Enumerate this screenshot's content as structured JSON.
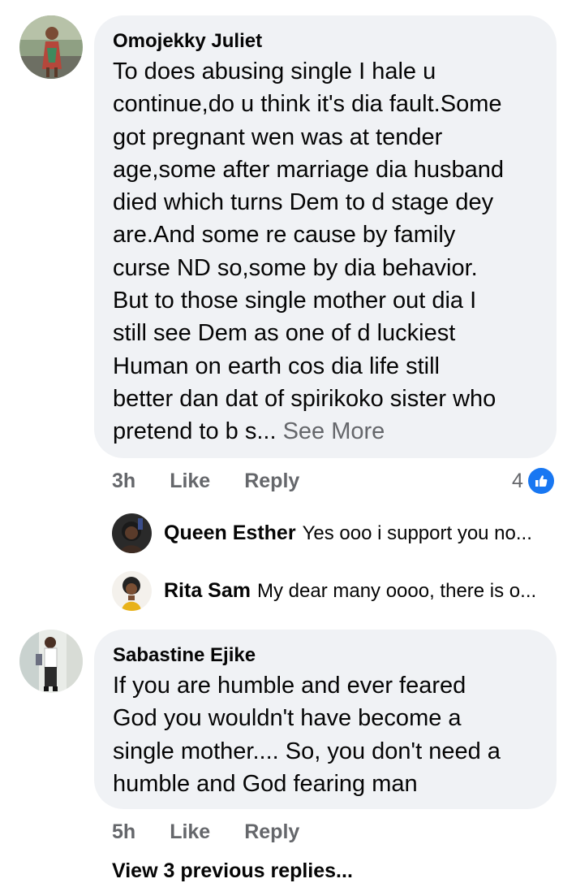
{
  "comments": [
    {
      "author": "Omojekky Juliet",
      "lines": [
        "To does abusing single I hale u",
        "continue,do u think it's dia fault.Some",
        "got pregnant wen was at tender",
        "age,some after marriage dia husband",
        "died which turns Dem to d stage dey",
        "are.And some re cause by family",
        "curse ND so,some by dia behavior.",
        "But to those single mother out dia I",
        "still see Dem as one of d luckiest",
        "Human on earth cos dia life still",
        "better dan dat of spirikoko sister who",
        "pretend to b s..."
      ],
      "see_more": "See More",
      "time": "3h",
      "like_label": "Like",
      "reply_label": "Reply",
      "reaction_count": "4",
      "reaction_icon": "like-thumb-icon",
      "replies": [
        {
          "author": "Queen Esther",
          "text": "Yes ooo i support you no..."
        },
        {
          "author": "Rita Sam",
          "text": "My dear many oooo, there is o..."
        }
      ]
    },
    {
      "author": "Sabastine Ejike",
      "lines": [
        "If you are humble and ever feared",
        "God you wouldn't have become a",
        "single mother.... So, you don't need a",
        "humble and God fearing man"
      ],
      "time": "5h",
      "like_label": "Like",
      "reply_label": "Reply",
      "view_previous": "View 3 previous replies..."
    }
  ],
  "colors": {
    "bubble": "#f0f2f5",
    "meta": "#65676b",
    "accent": "#1877f2"
  }
}
